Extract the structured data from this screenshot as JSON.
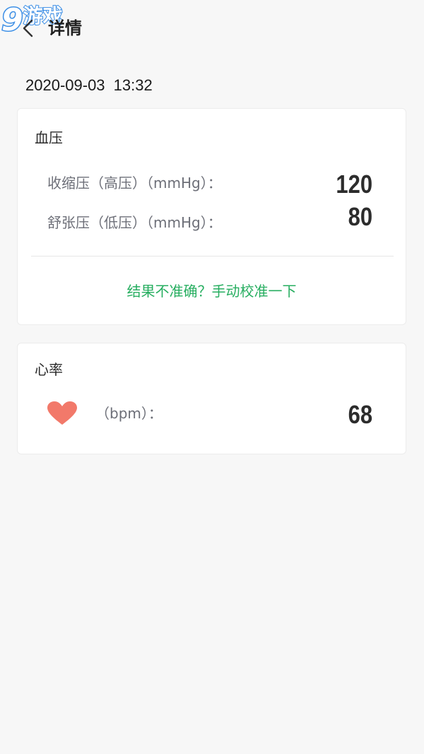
{
  "header": {
    "watermark_number": "9",
    "watermark_text": "游戏",
    "back_icon": "chevron-left-icon",
    "title": "详情"
  },
  "record": {
    "timestamp": "2020-09-03 13:32"
  },
  "blood_pressure": {
    "title": "血压",
    "systolic_label": "收缩压（高压）（mmHg）：",
    "systolic_value": "120",
    "diastolic_label": "舒张压（低压）（mmHg）：",
    "diastolic_value": "80",
    "calibrate_link": "结果不准确？手动校准一下"
  },
  "heart_rate": {
    "title": "心率",
    "icon": "heart-icon",
    "label": "（bpm）：",
    "value": "68"
  },
  "colors": {
    "background": "#f7f7f7",
    "card": "#ffffff",
    "link_green": "#27ae60",
    "heart": "#f2796a",
    "label_gray": "#6d6f78",
    "watermark_blue": "#3d8fe6"
  }
}
